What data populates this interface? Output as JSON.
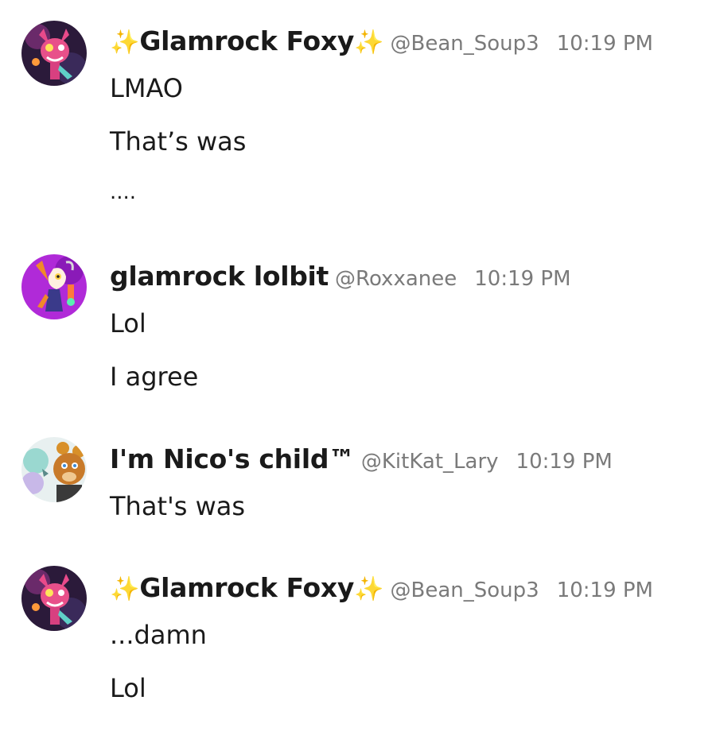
{
  "messages": [
    {
      "name_prefix_icon": "✨",
      "name": "Glamrock Foxy",
      "name_suffix_icon": "✨",
      "handle": "@Bean_Soup3",
      "time": "10:19 PM",
      "avatar_icon": "foxy-avatar",
      "lines": [
        "LMAO",
        "That’s was",
        "...."
      ]
    },
    {
      "name": "glamrock lolbit",
      "handle": "@Roxxanee",
      "time": "10:19 PM",
      "avatar_icon": "lolbit-avatar",
      "lines": [
        "Lol",
        "I agree"
      ]
    },
    {
      "name": "I'm Nico's child™",
      "handle": "@KitKat_Lary",
      "time": "10:19 PM",
      "avatar_icon": "freddy-avatar",
      "lines": [
        "That's was"
      ]
    },
    {
      "name_prefix_icon": "✨",
      "name": "Glamrock Foxy",
      "name_suffix_icon": "✨",
      "handle": "@Bean_Soup3",
      "time": "10:19 PM",
      "avatar_icon": "foxy-avatar",
      "lines": [
        "...damn",
        "Lol"
      ]
    }
  ],
  "colors": {
    "sparkle": "#f5c518",
    "meta_text": "#7a7a7a",
    "body_text": "#1a1a1a"
  }
}
